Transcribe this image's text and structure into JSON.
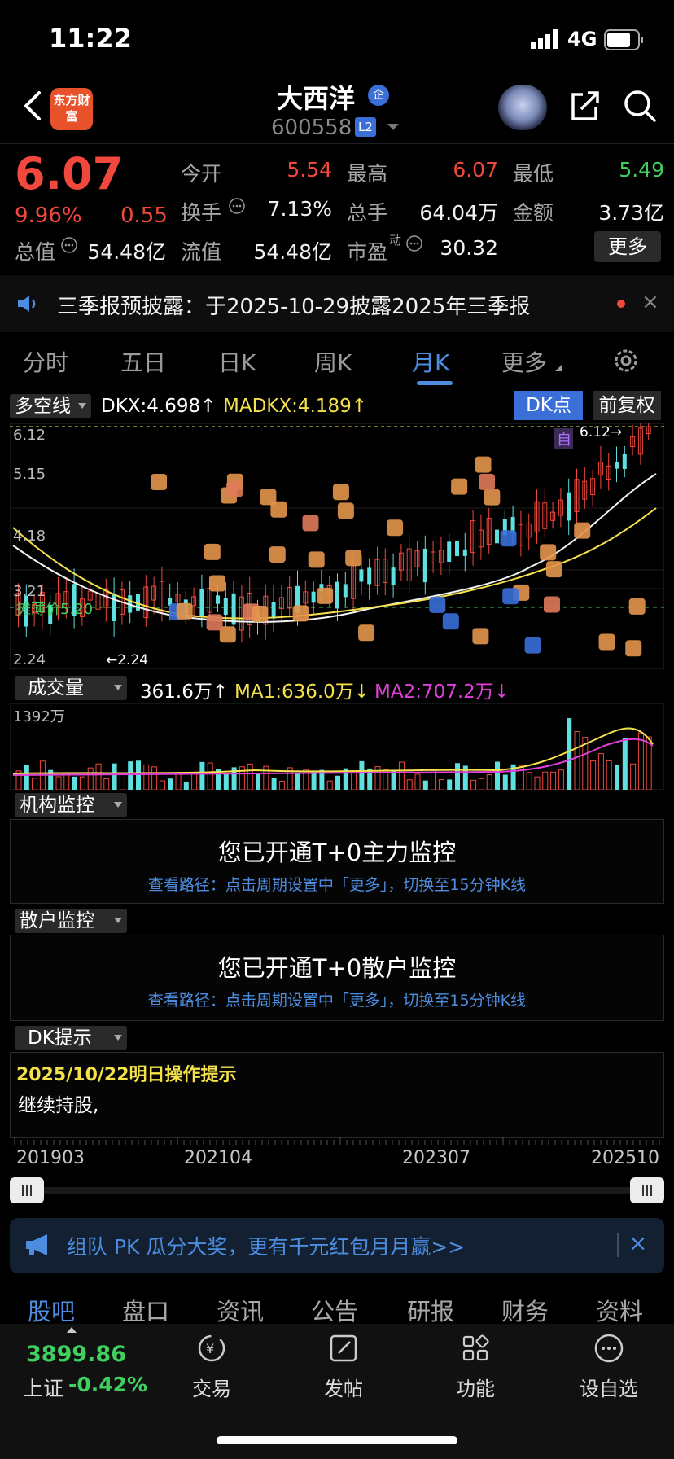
{
  "status_bar": {
    "time": "11:22",
    "network": "4G"
  },
  "header": {
    "logo_text": "东方财富",
    "stock_name": "大西洋",
    "name_badge": "企",
    "stock_code": "600558",
    "level_badge": "L2"
  },
  "quote": {
    "price": "6.07",
    "change_pct": "9.96%",
    "change": "0.55",
    "open_label": "今开",
    "open_value": "5.54",
    "high_label": "最高",
    "high_value": "6.07",
    "low_label": "最低",
    "low_value": "5.49",
    "turnover_label": "换手",
    "turnover_value": "7.13%",
    "volume_label": "总手",
    "volume_value": "64.04万",
    "amount_label": "金额",
    "amount_value": "3.73亿",
    "mktcap_label": "总值",
    "mktcap_value": "54.48亿",
    "float_label": "流值",
    "float_value": "54.48亿",
    "pe_label": "市盈",
    "pe_sup": "动",
    "pe_value": "30.32",
    "more_label": "更多"
  },
  "notice": {
    "text": "三季报预披露：于2025-10-29披露2025年三季报",
    "close": "×"
  },
  "period_tabs": [
    "分时",
    "五日",
    "日K",
    "周K",
    "月K",
    "更多"
  ],
  "indicator": {
    "selector": "多空线",
    "dkx": "DKX:4.698↑",
    "madkx": "MADKX:4.189↑",
    "dk_button": "DK点",
    "adjust_button": "前复权"
  },
  "kline": {
    "axis_labels": [
      "6.12",
      "5.15",
      "4.18",
      "3.21",
      "2.24"
    ],
    "high_marker": "6.12→",
    "low_marker": "←2.24",
    "cost_label": "摊薄价5.20",
    "self_marker": "自"
  },
  "volume": {
    "selector": "成交量",
    "value": "361.6万↑",
    "ma1": "MA1:636.0万↓",
    "ma2": "MA2:707.2万↓",
    "max_label": "1392万"
  },
  "institution_panel": {
    "selector": "机构监控",
    "title": "您已开通T+0主力监控",
    "subtitle": "查看路径：点击周期设置中「更多」，切换至15分钟K线"
  },
  "retail_panel": {
    "selector": "散户监控",
    "title": "您已开通T+0散户监控",
    "subtitle": "查看路径：点击周期设置中「更多」，切换至15分钟K线"
  },
  "dk_panel": {
    "selector": "DK提示",
    "date_text": "2025/10/22明日操作提示",
    "advice": "继续持股,"
  },
  "timeline": {
    "labels": [
      "201903",
      "202104",
      "202307",
      "202510"
    ]
  },
  "promo": {
    "text": "组队 PK 瓜分大奖，更有千元红包月月赢>>",
    "close": "×"
  },
  "bottom_tabs": [
    "股吧",
    "盘口",
    "资讯",
    "公告",
    "研报",
    "财务",
    "资料"
  ],
  "dock": {
    "index_value": "3899.86",
    "index_name": "上证",
    "index_change": "-0.42%",
    "items": [
      "交易",
      "发帖",
      "功能",
      "设自选"
    ]
  },
  "colors": {
    "up": "#f0483d",
    "down": "#3fd060",
    "accent": "#4d8de0",
    "candle_down": "#5ee0e0",
    "ma_yellow": "#f5e14a",
    "ma_magenta": "#e040d8"
  }
}
